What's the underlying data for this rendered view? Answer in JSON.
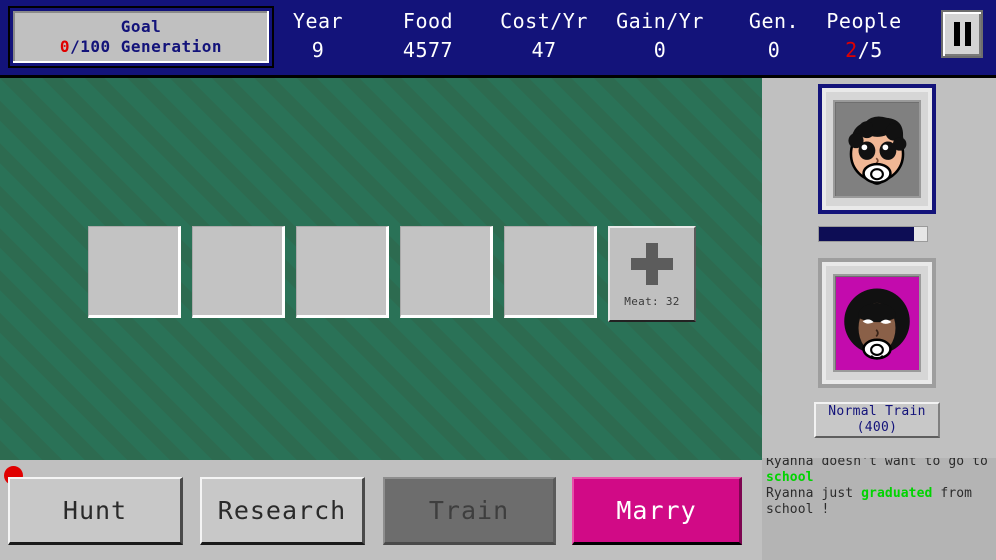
{
  "topbar": {
    "goal": {
      "title": "Goal",
      "current": "0",
      "target": "/100 Generation"
    },
    "stats": [
      {
        "key": "year",
        "label": "Year",
        "value": "9"
      },
      {
        "key": "food",
        "label": "Food",
        "value": "4577"
      },
      {
        "key": "cost",
        "label": "Cost/Yr",
        "value": "47"
      },
      {
        "key": "gain",
        "label": "Gain/Yr",
        "value": "0"
      },
      {
        "key": "gen",
        "label": "Gen.",
        "value": "0"
      },
      {
        "key": "people",
        "label": "People",
        "value_highlight": "2",
        "value_rest": "/5"
      }
    ],
    "pause_icon": "pause-icon"
  },
  "play_area": {
    "slot_count": 5,
    "add_button": {
      "icon": "plus-icon",
      "label": "Meat: 32"
    }
  },
  "sidebar": {
    "portrait_1": {
      "icon": "baby-face-curly-hair-pacifier-icon",
      "selected": true,
      "background_color": "#808080",
      "progress_percent": 88
    },
    "portrait_2": {
      "icon": "baby-face-afro-pacifier-icon",
      "selected": false,
      "background_color": "#c30bad"
    },
    "train_button": {
      "label": "Normal Train",
      "cost": "(400)"
    }
  },
  "log": {
    "lines": [
      {
        "pre": "Ryanna doesn't want to go to ",
        "highlight": "school",
        "post": ""
      },
      {
        "pre": "Ryanna just ",
        "highlight": "graduated",
        "post": " from school !"
      }
    ]
  },
  "actions": {
    "status_indicator": "red-dot",
    "buttons": [
      {
        "key": "hunt",
        "label": "Hunt",
        "state": "enabled"
      },
      {
        "key": "research",
        "label": "Research",
        "state": "enabled"
      },
      {
        "key": "train",
        "label": "Train",
        "state": "disabled"
      },
      {
        "key": "marry",
        "label": "Marry",
        "state": "highlighted"
      }
    ]
  },
  "colors": {
    "header_blue": "#13137a",
    "field_green": "#2d6b50",
    "panel_gray": "#c0c0c0",
    "accent_magenta": "#d10a86",
    "alert_red": "#e00000",
    "log_green": "#00d400"
  }
}
